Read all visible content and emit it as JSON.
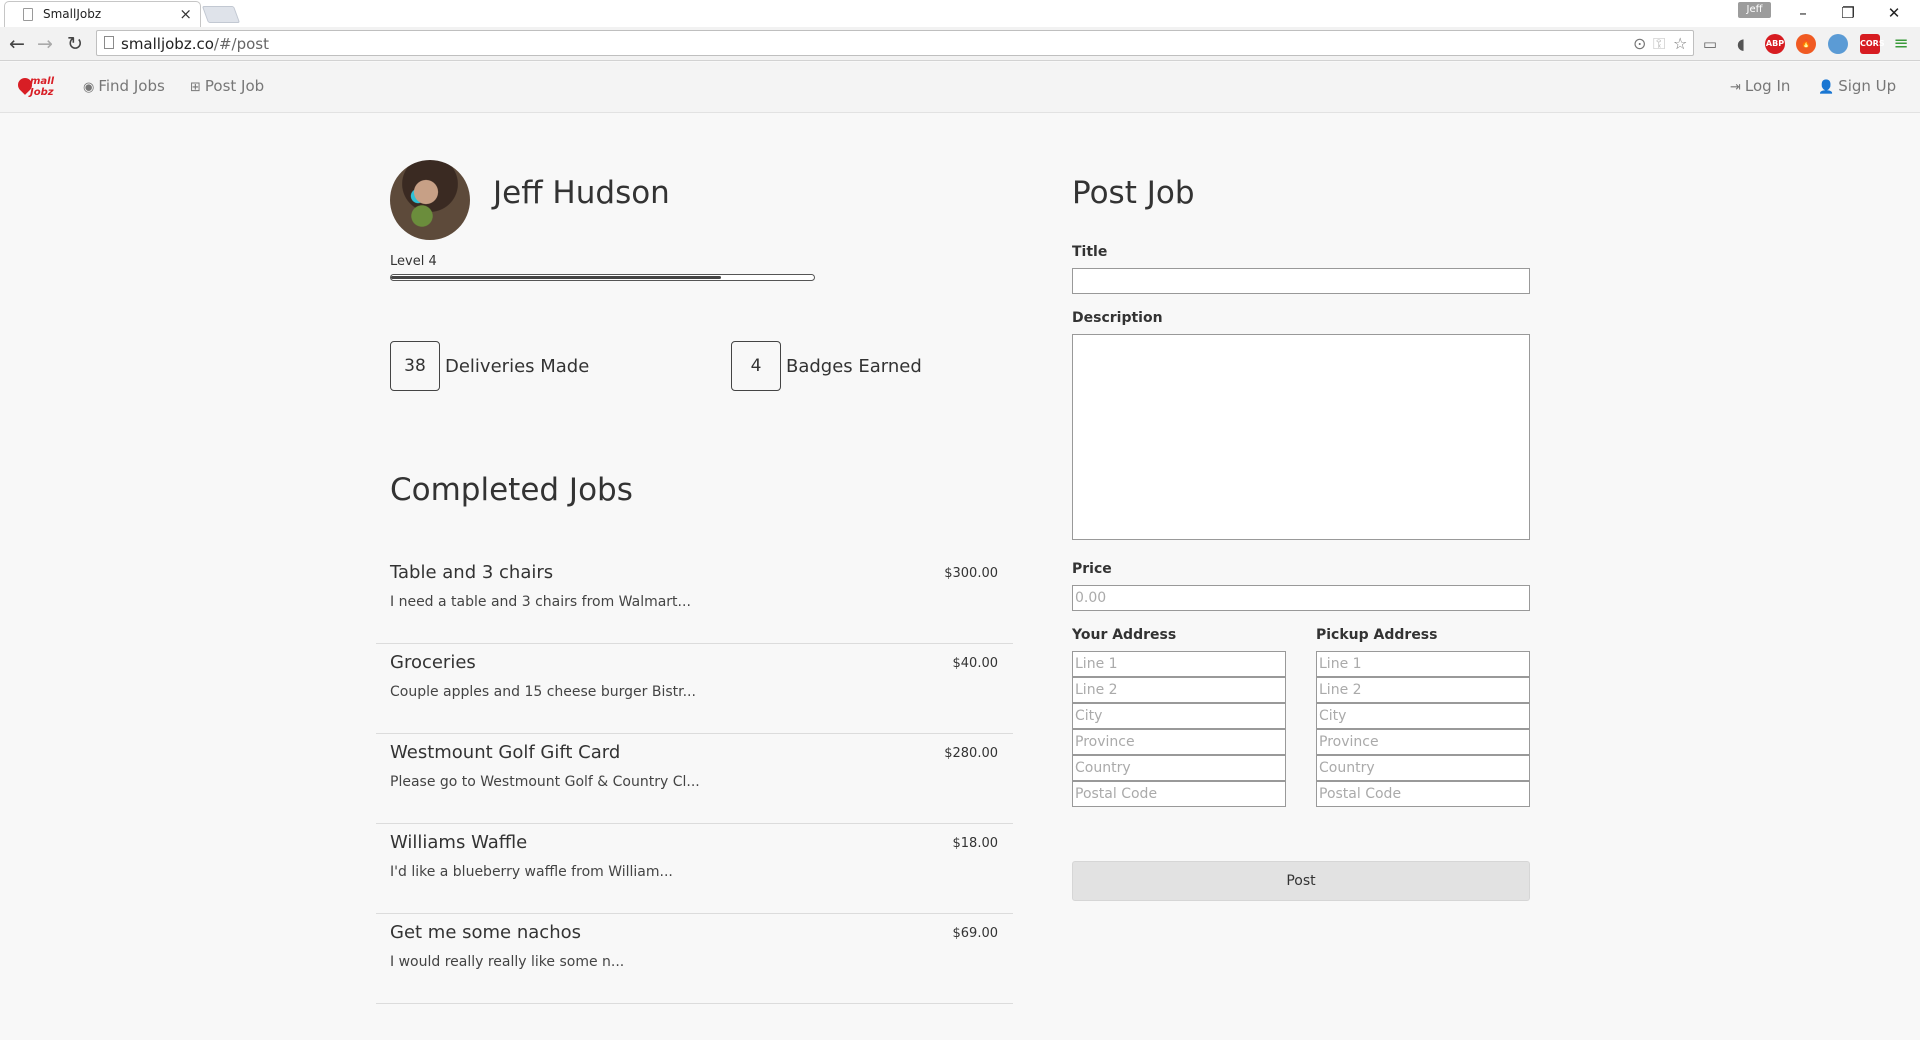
{
  "browser": {
    "tab_title": "SmallJobz",
    "tab_close": "×",
    "profile_name": "Jeff",
    "url_host": "smalljobz.co",
    "url_path": "/#/post",
    "extensions": [
      {
        "name": "abp",
        "label": "ABP",
        "color": "#d71c21"
      },
      {
        "name": "fire",
        "label": "",
        "color": "#f05a22"
      },
      {
        "name": "camera",
        "label": "",
        "color": "#5b9bd5"
      },
      {
        "name": "cors",
        "label": "CORS",
        "color": "#d71c21"
      }
    ]
  },
  "navbar": {
    "logo_text_line1": "mall",
    "logo_text_line2": "Jobz",
    "find_jobs": "Find Jobs",
    "post_job": "Post Job",
    "log_in": "Log In",
    "sign_up": "Sign Up"
  },
  "profile": {
    "name": "Jeff Hudson",
    "level_label": "Level 4",
    "level_progress": 0.78,
    "deliveries_count": "38",
    "deliveries_label": "Deliveries Made",
    "badges_count": "4",
    "badges_label": "Badges Earned"
  },
  "completed_jobs": {
    "heading": "Completed Jobs",
    "items": [
      {
        "title": "Table and 3 chairs",
        "description": "I need a table and 3 chairs from Walmart...",
        "price": "$300.00"
      },
      {
        "title": "Groceries",
        "description": "Couple apples and 15 cheese burger Bistr...",
        "price": "$40.00"
      },
      {
        "title": "Westmount Golf Gift Card",
        "description": "Please go to Westmount Golf & Country Cl...",
        "price": "$280.00"
      },
      {
        "title": "Williams Waffle",
        "description": "I'd like a blueberry waffle from William...",
        "price": "$18.00"
      },
      {
        "title": "Get me some nachos",
        "description": "I would really really like some n...",
        "price": "$69.00"
      }
    ]
  },
  "post_form": {
    "heading": "Post Job",
    "title_label": "Title",
    "title_value": "",
    "description_label": "Description",
    "description_value": "",
    "price_label": "Price",
    "price_placeholder": "0.00",
    "your_address_label": "Your Address",
    "pickup_address_label": "Pickup Address",
    "address_placeholders": {
      "line1": "Line 1",
      "line2": "Line 2",
      "city": "City",
      "province": "Province",
      "country": "Country",
      "postal": "Postal Code"
    },
    "submit_label": "Post"
  }
}
